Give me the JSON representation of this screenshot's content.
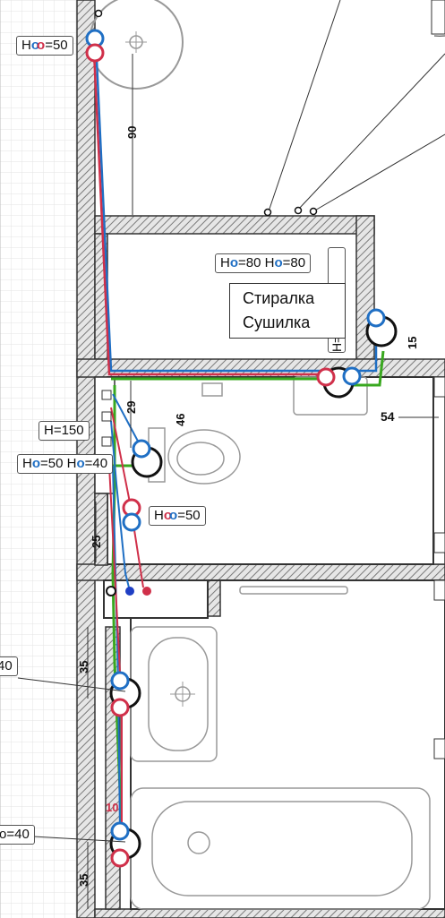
{
  "labels": {
    "top_sink": {
      "prefix": "H",
      "suffix": "=50"
    },
    "washer": {
      "p1": "H",
      "v1": "=80",
      "p2": "H",
      "v2": "=80"
    },
    "washer_name_line1": "Стиралка",
    "washer_name_line2": "Сушилка",
    "vertical_tag": "H=40",
    "h150": "H=150",
    "wc": {
      "p1": "H",
      "v1": "=50",
      "p2": "H",
      "v2": "=40"
    },
    "mid": {
      "prefix": "H",
      "suffix": "=50"
    },
    "left_cut_1": "40",
    "left_cut_2": "o=40"
  },
  "dimensions": {
    "d90": "90",
    "d15": "15",
    "d54": "54",
    "d29": "29",
    "d46": "46",
    "d25": "25",
    "d35a": "35",
    "d35b": "35",
    "red10": "10"
  },
  "colors": {
    "cold": "#1f6fc4",
    "hot": "#d0304a",
    "drain": "#39a81f",
    "wall_hatch": "#8a8a8a",
    "fixture": "#9a9a9a"
  }
}
